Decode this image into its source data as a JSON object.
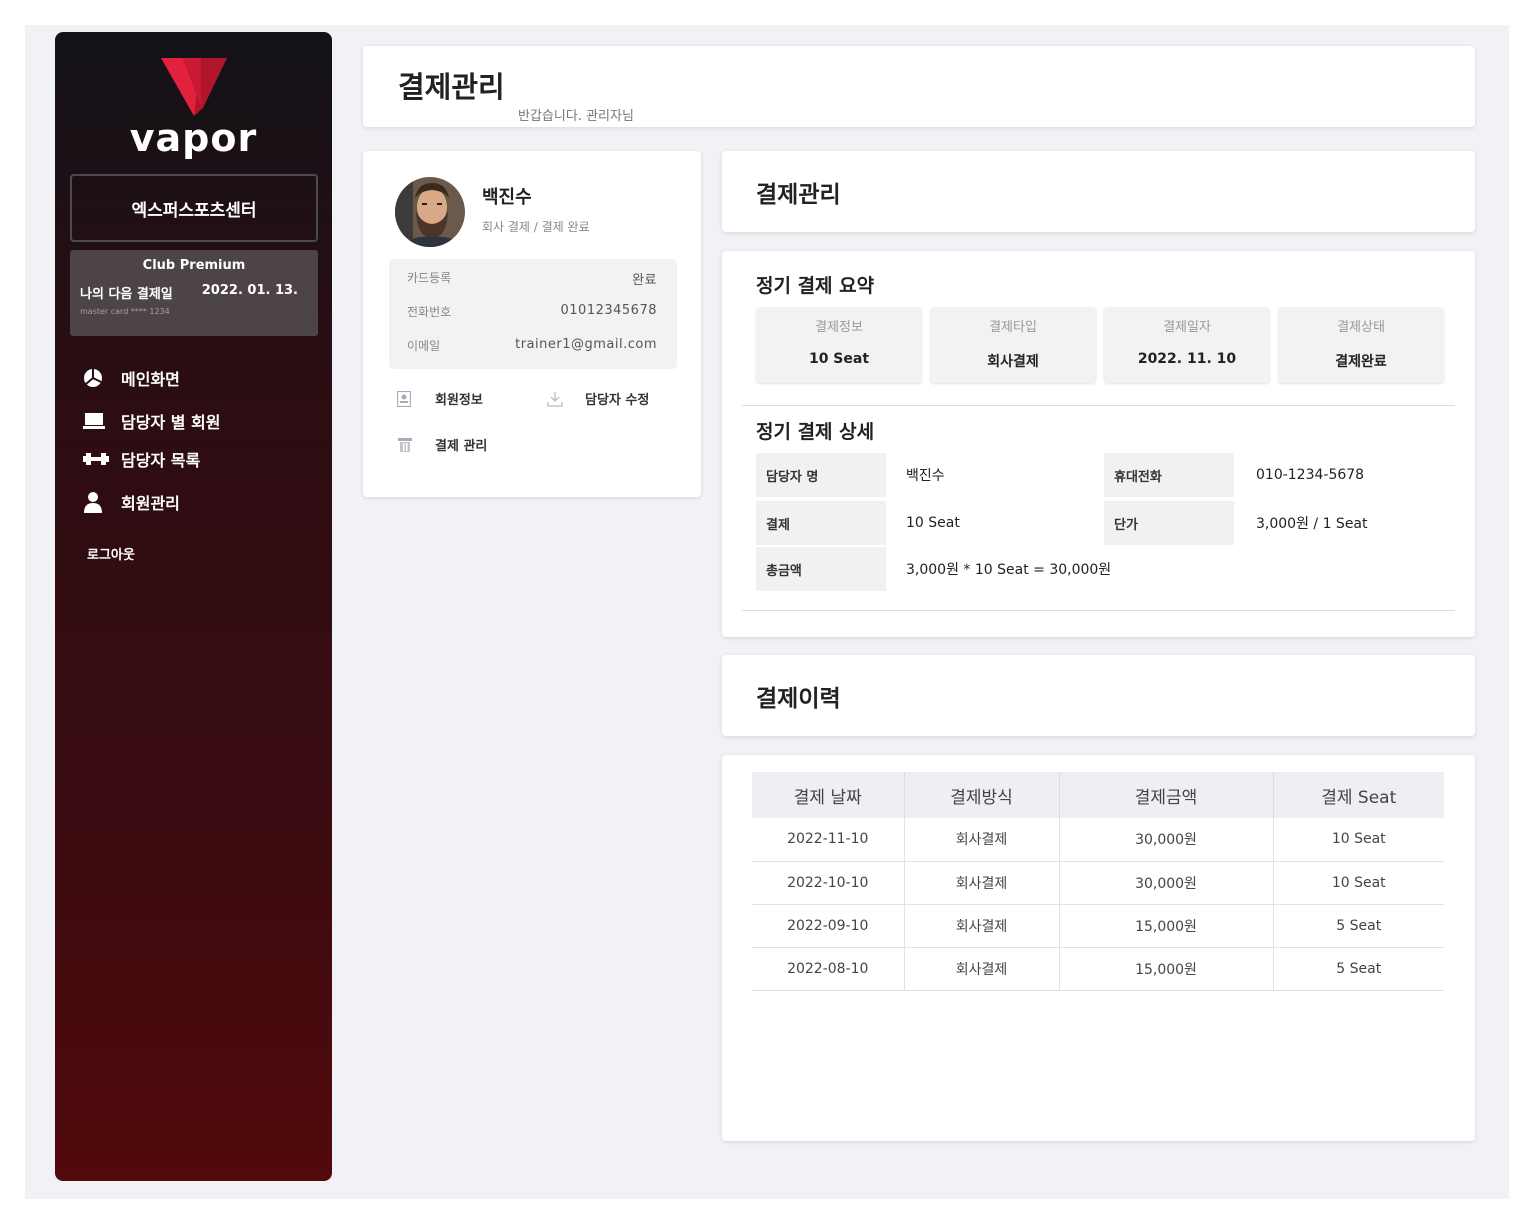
{
  "brand": {
    "name": "vapor",
    "accent": "#e4213d"
  },
  "sidebar": {
    "center_name": "엑스퍼스포츠센터",
    "premium": {
      "title": "Club Premium",
      "next_payment_label": "나의 다음 결제일",
      "next_payment_date": "2022. 01. 13.",
      "card": "master card **** 1234"
    },
    "menu": [
      {
        "label": "메인화면",
        "icon": "pie-chart-icon"
      },
      {
        "label": "담당자 별 회원",
        "icon": "laptop-icon"
      },
      {
        "label": "담당자 목록",
        "icon": "dumbbell-icon"
      },
      {
        "label": "회원관리",
        "icon": "user-icon"
      }
    ],
    "logout": "로그아웃"
  },
  "header": {
    "title": "결제관리",
    "subtitle": "반갑습니다. 관리자님"
  },
  "profile": {
    "name": "백진수",
    "status": "회사 결제 / 결제 완료",
    "info": [
      {
        "label": "카드등록",
        "value": "완료"
      },
      {
        "label": "전화번호",
        "value": "01012345678"
      },
      {
        "label": "이메일",
        "value": "trainer1@gmail.com"
      }
    ],
    "actions": {
      "member_info": "회원정보",
      "edit_manager": "담당자 수정",
      "payment_manage": "결제 관리"
    }
  },
  "payment": {
    "section_title": "결제관리",
    "summary_title": "정기 결제 요약",
    "summary": [
      {
        "label": "결제정보",
        "value": "10 Seat"
      },
      {
        "label": "결제타입",
        "value": "회사결제"
      },
      {
        "label": "결제일자",
        "value": "2022. 11. 10"
      },
      {
        "label": "결제상태",
        "value": "결제완료"
      }
    ],
    "detail_title": "정기 결제 상세",
    "detail": {
      "manager_label": "담당자 명",
      "manager_value": "백진수",
      "phone_label": "휴대전화",
      "phone_value": "010-1234-5678",
      "payment_label": "결제",
      "payment_value": "10 Seat",
      "unit_label": "단가",
      "unit_value": "3,000원 / 1 Seat",
      "total_label": "총금액",
      "total_value": "3,000원 * 10 Seat = 30,000원"
    }
  },
  "history": {
    "title": "결제이력",
    "columns": [
      "결제 날짜",
      "결제방식",
      "결제금액",
      "결제 Seat"
    ],
    "rows": [
      [
        "2022-11-10",
        "회사결제",
        "30,000원",
        "10 Seat"
      ],
      [
        "2022-10-10",
        "회사결제",
        "30,000원",
        "10 Seat"
      ],
      [
        "2022-09-10",
        "회사결제",
        "15,000원",
        "5 Seat"
      ],
      [
        "2022-08-10",
        "회사결제",
        "15,000원",
        "5 Seat"
      ]
    ]
  }
}
